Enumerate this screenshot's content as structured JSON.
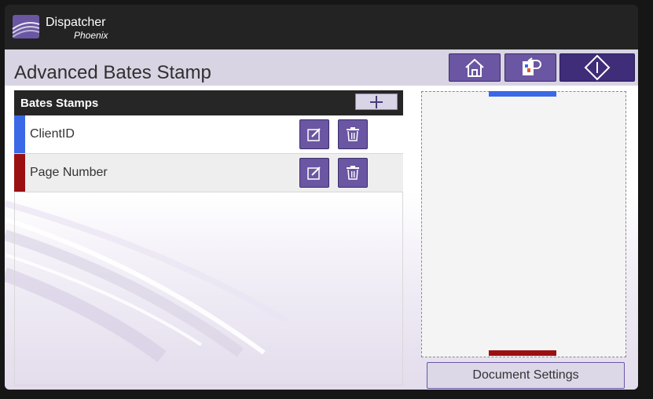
{
  "brand": {
    "name": "Dispatcher",
    "sub": "Phoenix",
    "logo_icon": "dispatcher-logo-icon"
  },
  "page": {
    "title": "Advanced Bates Stamp"
  },
  "nav": {
    "home_icon": "home-icon",
    "back_icon": "back-to-document-icon",
    "start_icon": "start-icon"
  },
  "stamps": {
    "title": "Bates Stamps",
    "add_icon": "plus-icon",
    "items": [
      {
        "label": "ClientID",
        "color": "#3a68e6",
        "edit_icon": "edit-icon",
        "delete_icon": "trash-icon"
      },
      {
        "label": "Page Number",
        "color": "#9b0f12",
        "edit_icon": "edit-icon",
        "delete_icon": "trash-icon"
      }
    ]
  },
  "preview": {
    "top_marker_color": "#3a68e6",
    "bottom_marker_color": "#9b0f12"
  },
  "document_settings": {
    "label": "Document Settings"
  },
  "colors": {
    "accent": "#6a56a2",
    "accent_dark": "#3f2d79",
    "header_band": "#d8d4e3",
    "topbar": "#232323"
  }
}
